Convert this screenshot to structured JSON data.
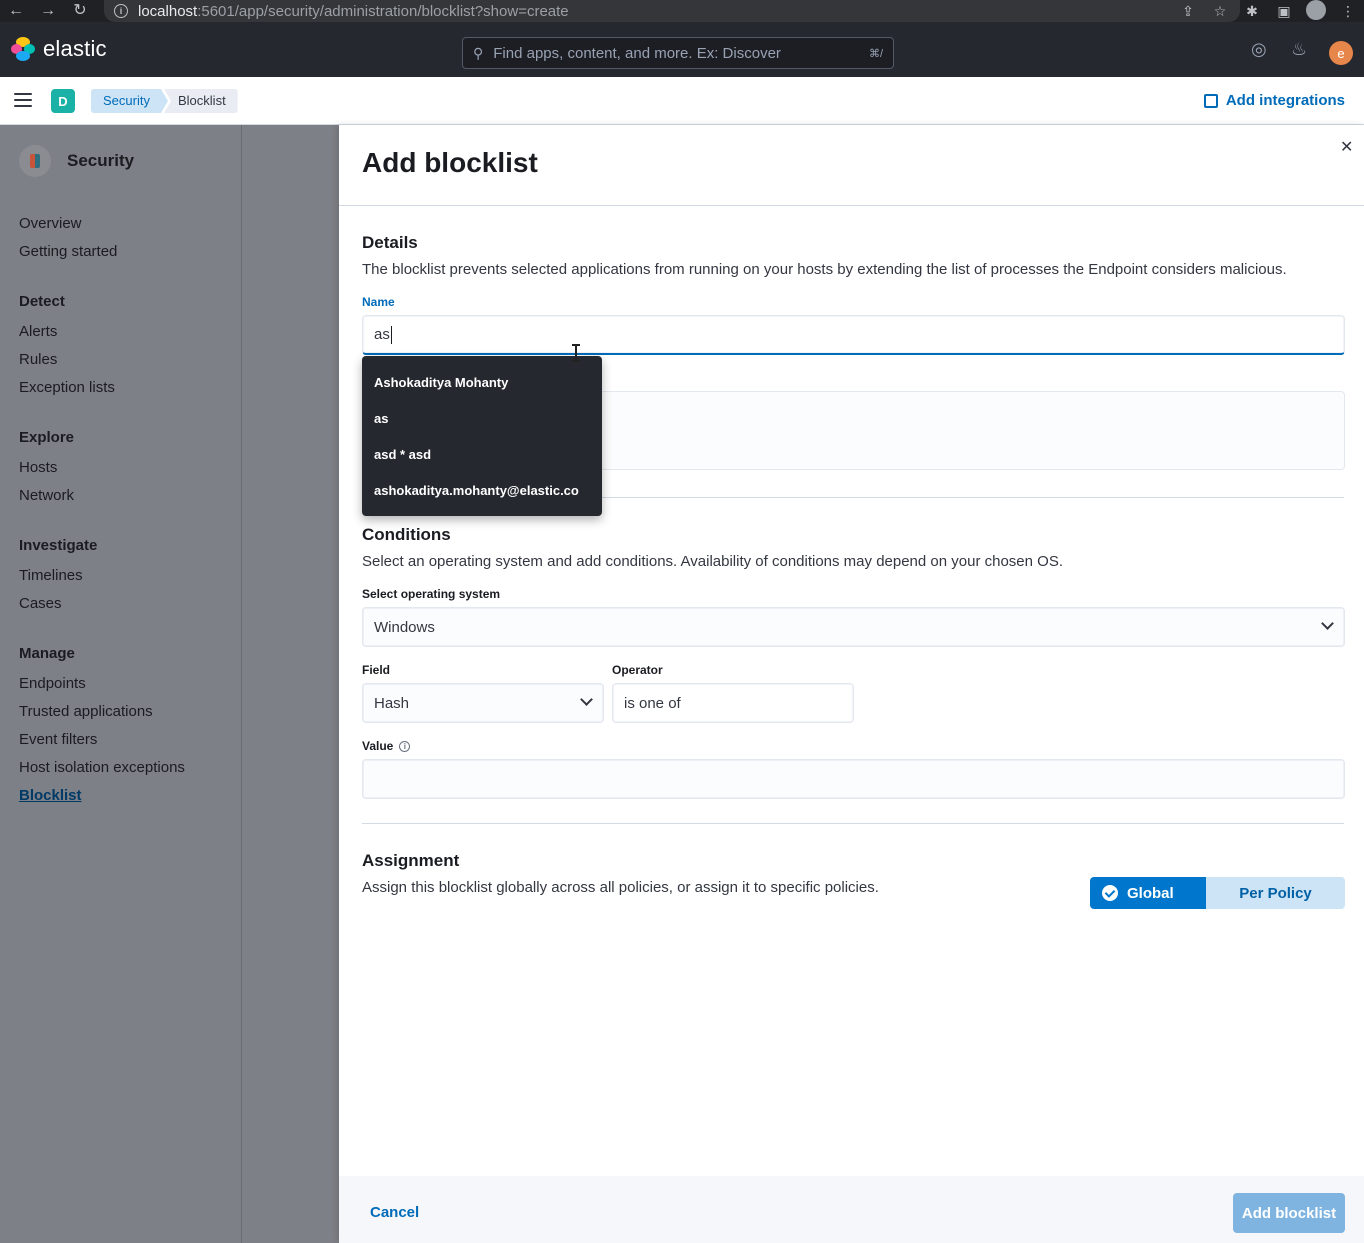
{
  "browser": {
    "url_host": "localhost",
    "url_path": ":5601/app/security/administration/blocklist?show=create"
  },
  "header": {
    "logo_text": "elastic",
    "search_placeholder": "Find apps, content, and more. Ex: Discover",
    "search_shortcut": "⌘/",
    "user_initial": "e"
  },
  "breadcrumbs": {
    "space_initial": "D",
    "items": [
      "Security",
      "Blocklist"
    ],
    "add_integrations": "Add integrations"
  },
  "sidebar": {
    "title": "Security",
    "top_items": [
      "Overview",
      "Getting started"
    ],
    "groups": [
      {
        "label": "Detect",
        "items": [
          "Alerts",
          "Rules",
          "Exception lists"
        ]
      },
      {
        "label": "Explore",
        "items": [
          "Hosts",
          "Network"
        ]
      },
      {
        "label": "Investigate",
        "items": [
          "Timelines",
          "Cases"
        ]
      },
      {
        "label": "Manage",
        "items": [
          "Endpoints",
          "Trusted applications",
          "Event filters",
          "Host isolation exceptions",
          "Blocklist"
        ]
      }
    ],
    "active_item": "Blocklist"
  },
  "flyout": {
    "title": "Add blocklist",
    "details": {
      "title": "Details",
      "description": "The blocklist prevents selected applications from running on your hosts by extending the list of processes the Endpoint considers malicious.",
      "name_label": "Name",
      "name_value": "as"
    },
    "autocomplete": [
      "Ashokaditya Mohanty",
      "as",
      "asd * asd",
      "ashokaditya.mohanty@elastic.co"
    ],
    "conditions": {
      "title": "Conditions",
      "description": "Select an operating system and add conditions. Availability of conditions may depend on your chosen OS.",
      "os_label": "Select operating system",
      "os_value": "Windows",
      "field_label": "Field",
      "field_value": "Hash",
      "operator_label": "Operator",
      "operator_value": "is one of",
      "value_label": "Value",
      "value_value": ""
    },
    "assignment": {
      "title": "Assignment",
      "description": "Assign this blocklist globally across all policies, or assign it to specific policies.",
      "global_label": "Global",
      "per_policy_label": "Per Policy"
    },
    "footer": {
      "cancel_label": "Cancel",
      "submit_label": "Add blocklist"
    }
  }
}
